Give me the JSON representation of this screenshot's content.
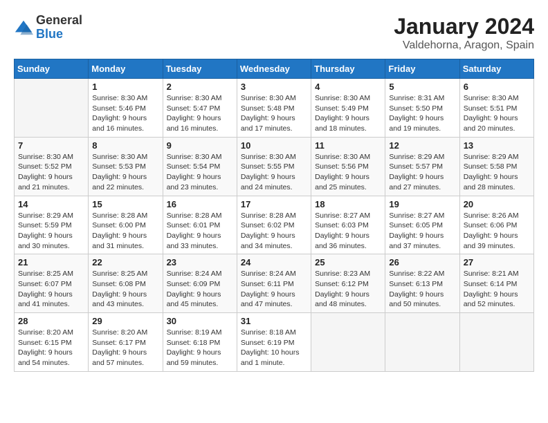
{
  "header": {
    "logo_general": "General",
    "logo_blue": "Blue",
    "month_title": "January 2024",
    "subtitle": "Valdehorna, Aragon, Spain"
  },
  "days_of_week": [
    "Sunday",
    "Monday",
    "Tuesday",
    "Wednesday",
    "Thursday",
    "Friday",
    "Saturday"
  ],
  "weeks": [
    [
      {
        "day": "",
        "info": ""
      },
      {
        "day": "1",
        "info": "Sunrise: 8:30 AM\nSunset: 5:46 PM\nDaylight: 9 hours\nand 16 minutes."
      },
      {
        "day": "2",
        "info": "Sunrise: 8:30 AM\nSunset: 5:47 PM\nDaylight: 9 hours\nand 16 minutes."
      },
      {
        "day": "3",
        "info": "Sunrise: 8:30 AM\nSunset: 5:48 PM\nDaylight: 9 hours\nand 17 minutes."
      },
      {
        "day": "4",
        "info": "Sunrise: 8:30 AM\nSunset: 5:49 PM\nDaylight: 9 hours\nand 18 minutes."
      },
      {
        "day": "5",
        "info": "Sunrise: 8:31 AM\nSunset: 5:50 PM\nDaylight: 9 hours\nand 19 minutes."
      },
      {
        "day": "6",
        "info": "Sunrise: 8:30 AM\nSunset: 5:51 PM\nDaylight: 9 hours\nand 20 minutes."
      }
    ],
    [
      {
        "day": "7",
        "info": "Sunrise: 8:30 AM\nSunset: 5:52 PM\nDaylight: 9 hours\nand 21 minutes."
      },
      {
        "day": "8",
        "info": "Sunrise: 8:30 AM\nSunset: 5:53 PM\nDaylight: 9 hours\nand 22 minutes."
      },
      {
        "day": "9",
        "info": "Sunrise: 8:30 AM\nSunset: 5:54 PM\nDaylight: 9 hours\nand 23 minutes."
      },
      {
        "day": "10",
        "info": "Sunrise: 8:30 AM\nSunset: 5:55 PM\nDaylight: 9 hours\nand 24 minutes."
      },
      {
        "day": "11",
        "info": "Sunrise: 8:30 AM\nSunset: 5:56 PM\nDaylight: 9 hours\nand 25 minutes."
      },
      {
        "day": "12",
        "info": "Sunrise: 8:29 AM\nSunset: 5:57 PM\nDaylight: 9 hours\nand 27 minutes."
      },
      {
        "day": "13",
        "info": "Sunrise: 8:29 AM\nSunset: 5:58 PM\nDaylight: 9 hours\nand 28 minutes."
      }
    ],
    [
      {
        "day": "14",
        "info": "Sunrise: 8:29 AM\nSunset: 5:59 PM\nDaylight: 9 hours\nand 30 minutes."
      },
      {
        "day": "15",
        "info": "Sunrise: 8:28 AM\nSunset: 6:00 PM\nDaylight: 9 hours\nand 31 minutes."
      },
      {
        "day": "16",
        "info": "Sunrise: 8:28 AM\nSunset: 6:01 PM\nDaylight: 9 hours\nand 33 minutes."
      },
      {
        "day": "17",
        "info": "Sunrise: 8:28 AM\nSunset: 6:02 PM\nDaylight: 9 hours\nand 34 minutes."
      },
      {
        "day": "18",
        "info": "Sunrise: 8:27 AM\nSunset: 6:03 PM\nDaylight: 9 hours\nand 36 minutes."
      },
      {
        "day": "19",
        "info": "Sunrise: 8:27 AM\nSunset: 6:05 PM\nDaylight: 9 hours\nand 37 minutes."
      },
      {
        "day": "20",
        "info": "Sunrise: 8:26 AM\nSunset: 6:06 PM\nDaylight: 9 hours\nand 39 minutes."
      }
    ],
    [
      {
        "day": "21",
        "info": "Sunrise: 8:25 AM\nSunset: 6:07 PM\nDaylight: 9 hours\nand 41 minutes."
      },
      {
        "day": "22",
        "info": "Sunrise: 8:25 AM\nSunset: 6:08 PM\nDaylight: 9 hours\nand 43 minutes."
      },
      {
        "day": "23",
        "info": "Sunrise: 8:24 AM\nSunset: 6:09 PM\nDaylight: 9 hours\nand 45 minutes."
      },
      {
        "day": "24",
        "info": "Sunrise: 8:24 AM\nSunset: 6:11 PM\nDaylight: 9 hours\nand 47 minutes."
      },
      {
        "day": "25",
        "info": "Sunrise: 8:23 AM\nSunset: 6:12 PM\nDaylight: 9 hours\nand 48 minutes."
      },
      {
        "day": "26",
        "info": "Sunrise: 8:22 AM\nSunset: 6:13 PM\nDaylight: 9 hours\nand 50 minutes."
      },
      {
        "day": "27",
        "info": "Sunrise: 8:21 AM\nSunset: 6:14 PM\nDaylight: 9 hours\nand 52 minutes."
      }
    ],
    [
      {
        "day": "28",
        "info": "Sunrise: 8:20 AM\nSunset: 6:15 PM\nDaylight: 9 hours\nand 54 minutes."
      },
      {
        "day": "29",
        "info": "Sunrise: 8:20 AM\nSunset: 6:17 PM\nDaylight: 9 hours\nand 57 minutes."
      },
      {
        "day": "30",
        "info": "Sunrise: 8:19 AM\nSunset: 6:18 PM\nDaylight: 9 hours\nand 59 minutes."
      },
      {
        "day": "31",
        "info": "Sunrise: 8:18 AM\nSunset: 6:19 PM\nDaylight: 10 hours\nand 1 minute."
      },
      {
        "day": "",
        "info": ""
      },
      {
        "day": "",
        "info": ""
      },
      {
        "day": "",
        "info": ""
      }
    ]
  ]
}
